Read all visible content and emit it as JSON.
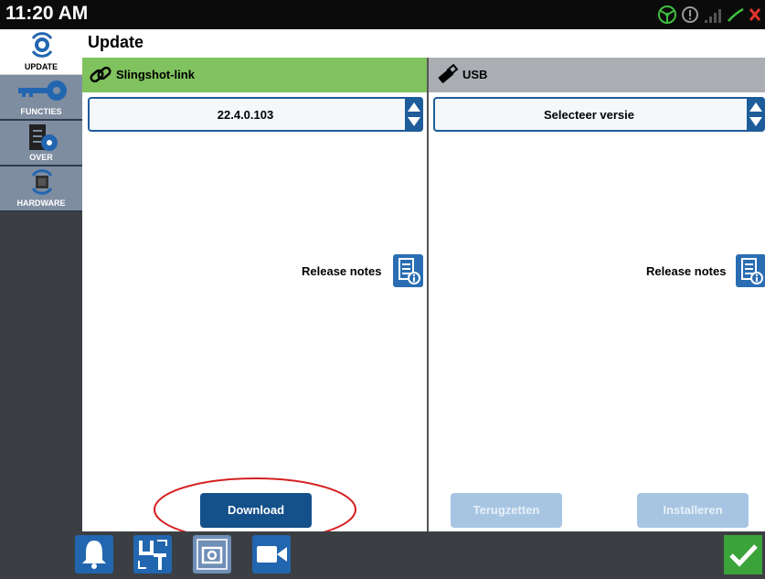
{
  "status": {
    "time": "11:20 AM"
  },
  "page_title": "Update",
  "sidebar": {
    "items": [
      {
        "label": "UPDATE",
        "icon": "update-gear-icon",
        "active": true
      },
      {
        "label": "FUNCTIES",
        "icon": "key-icon"
      },
      {
        "label": "OVER",
        "icon": "info-document-icon"
      },
      {
        "label": "HARDWARE",
        "icon": "hardware-chip-icon"
      }
    ]
  },
  "left_panel": {
    "title": "Slingshot-link",
    "icon": "link-icon",
    "version_value": "22.4.0.103",
    "release_notes_label": "Release notes",
    "download_label": "Download"
  },
  "right_panel": {
    "title": "USB",
    "icon": "usb-icon",
    "version_value": "Selecteer versie",
    "release_notes_label": "Release notes",
    "restore_label": "Terugzetten",
    "install_label": "Installeren"
  },
  "bottom_bar": {
    "icons": [
      "bell-icon",
      "ut-icon",
      "camera-icon",
      "video-icon",
      "confirm-check-icon"
    ]
  },
  "colors": {
    "active_header": "#80c25e",
    "inactive_header": "#aaaeb3",
    "primary_button": "#14508a",
    "disabled_button": "#a7c5e2",
    "annotation_circle": "#d62020"
  }
}
